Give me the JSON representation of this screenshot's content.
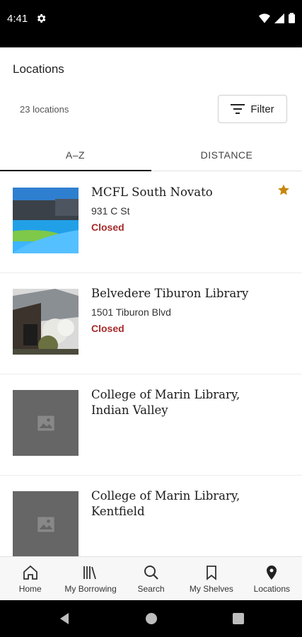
{
  "status_bar": {
    "time": "4:41"
  },
  "header": {
    "title": "Locations"
  },
  "toolbar": {
    "count_text": "23 locations",
    "filter_label": "Filter"
  },
  "tabs": [
    {
      "label": "A–Z",
      "selected": true
    },
    {
      "label": "DISTANCE",
      "selected": false
    }
  ],
  "locations": [
    {
      "name": "MCFL South Novato",
      "address": "931 C St",
      "status": "Closed",
      "favorite": true,
      "thumbnail": "photo-building"
    },
    {
      "name": "Belvedere Tiburon Library",
      "address": "1501 Tiburon Blvd",
      "status": "Closed",
      "favorite": false,
      "thumbnail": "photo-library"
    },
    {
      "name": "College of Marin Library, Indian Valley",
      "address": "",
      "status": "",
      "favorite": false,
      "thumbnail": "image-placeholder-icon"
    },
    {
      "name": "College of Marin Library, Kentfield",
      "address": "",
      "status": "",
      "favorite": false,
      "thumbnail": "image-placeholder-icon"
    }
  ],
  "bottom_nav": [
    {
      "label": "Home",
      "icon": "home-icon"
    },
    {
      "label": "My Borrowing",
      "icon": "books-icon"
    },
    {
      "label": "Search",
      "icon": "search-icon"
    },
    {
      "label": "My Shelves",
      "icon": "bookmark-icon"
    },
    {
      "label": "Locations",
      "icon": "location-pin-icon",
      "active": true
    }
  ],
  "colors": {
    "status_closed": "#a52a2a",
    "favorite_star": "#c8860b",
    "placeholder": "#666666"
  }
}
